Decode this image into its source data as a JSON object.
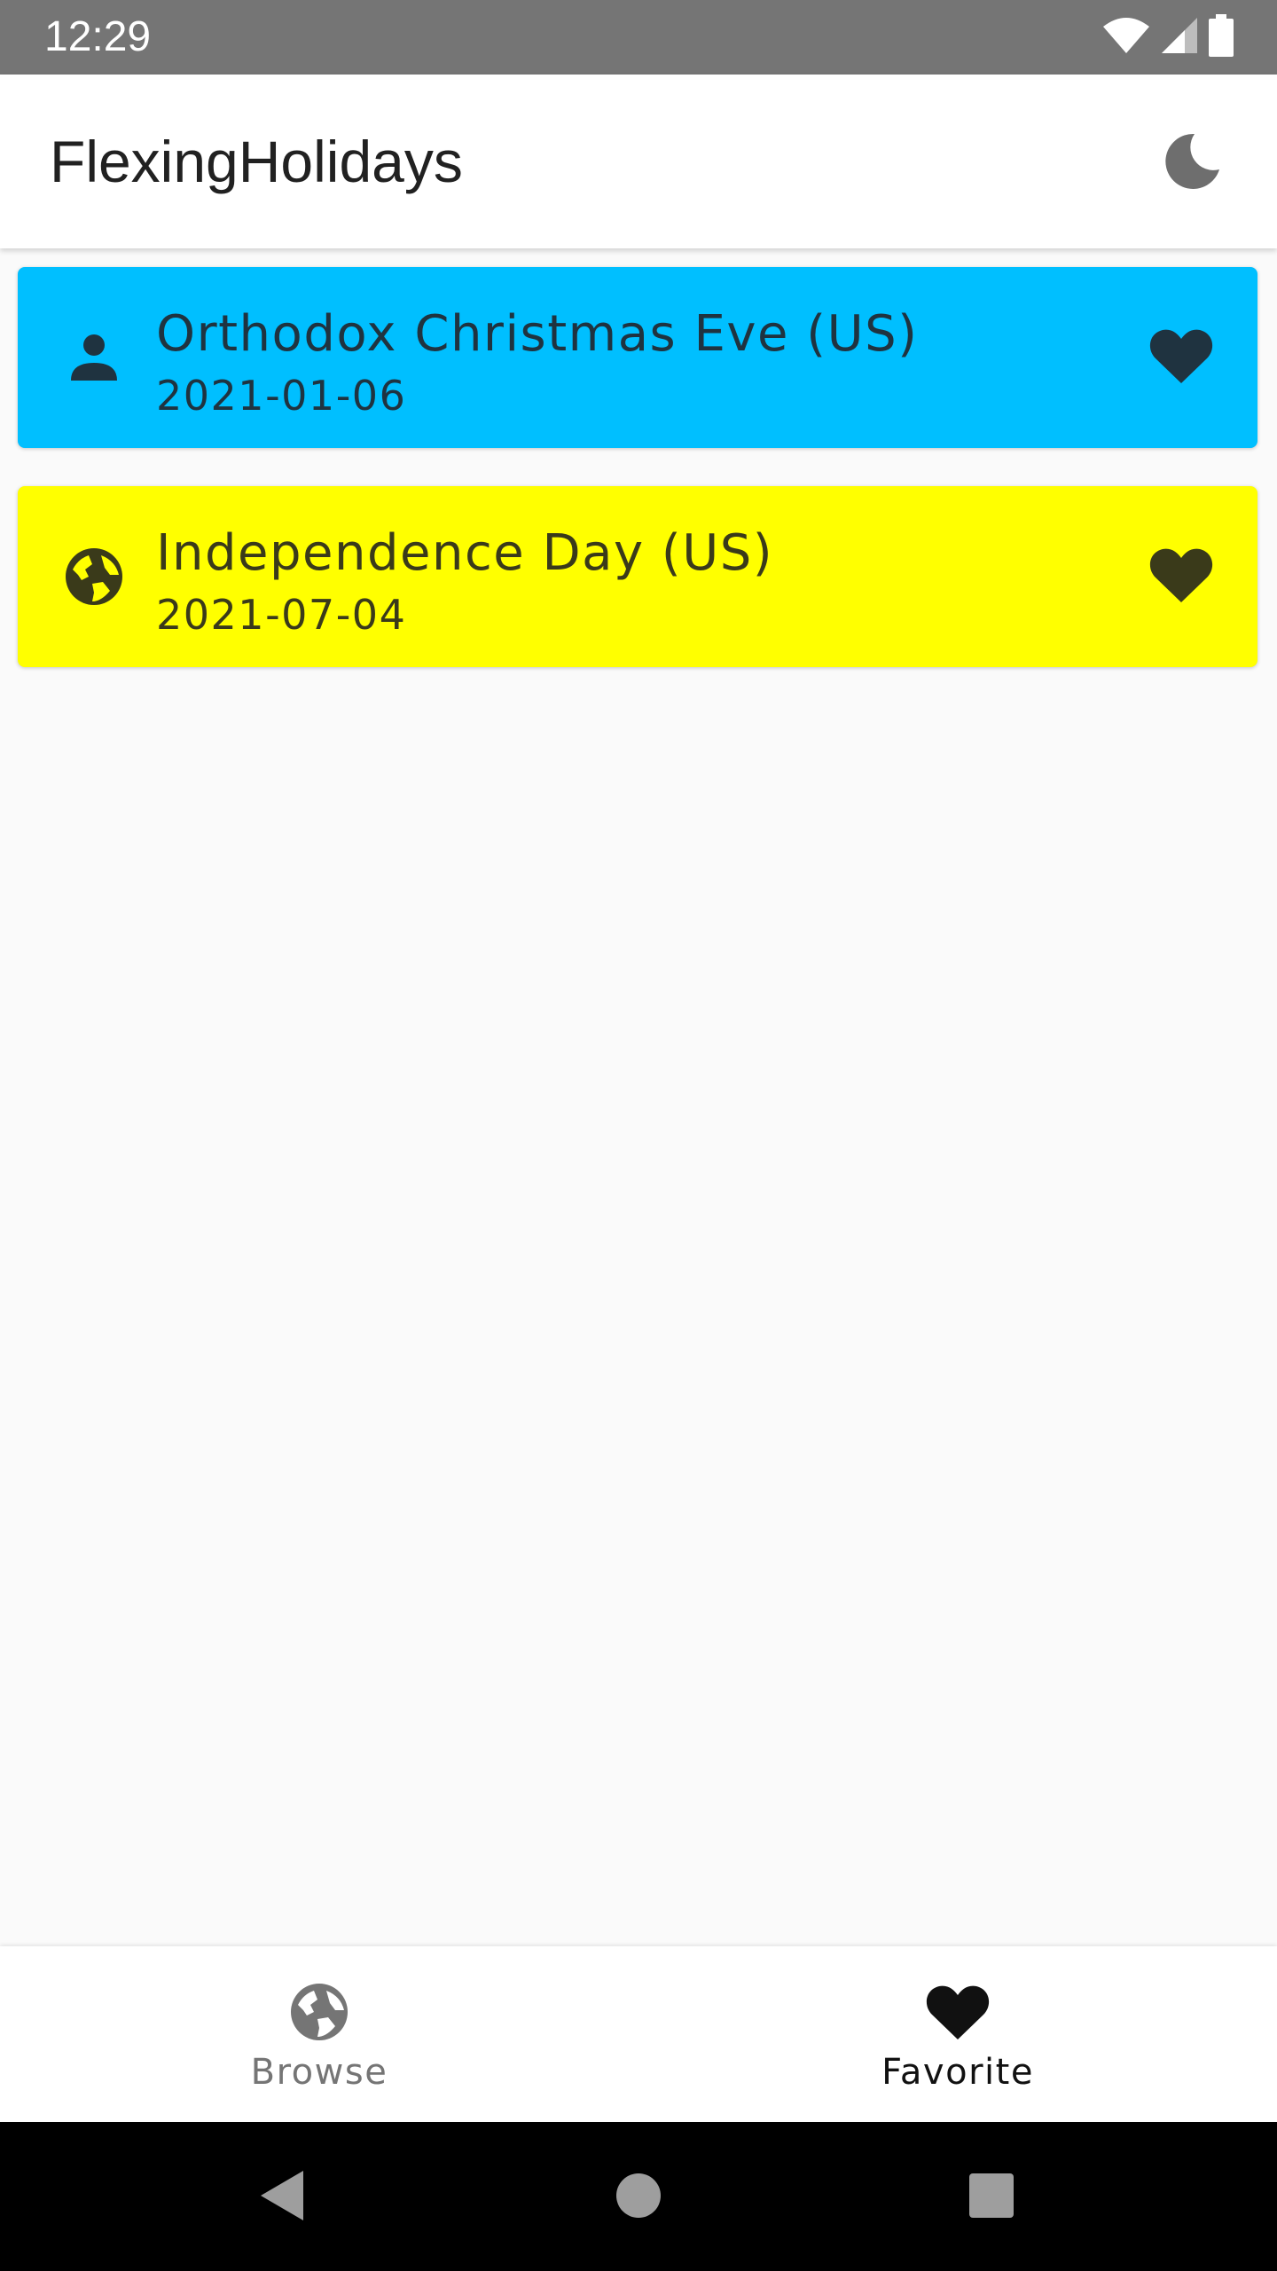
{
  "status_bar": {
    "time": "12:29",
    "icons": [
      "wifi-icon",
      "cell-signal-icon",
      "battery-icon"
    ]
  },
  "app_bar": {
    "title": "FlexingHolidays",
    "action_icon": "dark-mode-moon-icon"
  },
  "holidays": [
    {
      "name": "Orthodox Christmas Eve (US)",
      "date": "2021-01-06",
      "type_icon": "person-icon",
      "favorite_icon": "heart-icon",
      "background": "#00bfff",
      "text_color": "#1f3340"
    },
    {
      "name": "Independence Day (US)",
      "date": "2021-07-04",
      "type_icon": "globe-icon",
      "favorite_icon": "heart-icon",
      "background": "#ffff00",
      "text_color": "#3a3a1a"
    }
  ],
  "bottom_nav": {
    "items": [
      {
        "label": "Browse",
        "icon": "globe-icon",
        "selected": false,
        "color": "#757575"
      },
      {
        "label": "Favorite",
        "icon": "heart-icon",
        "selected": true,
        "color": "#111111"
      }
    ]
  },
  "system_nav": {
    "buttons": [
      "back-icon",
      "home-icon",
      "recents-icon"
    ]
  }
}
